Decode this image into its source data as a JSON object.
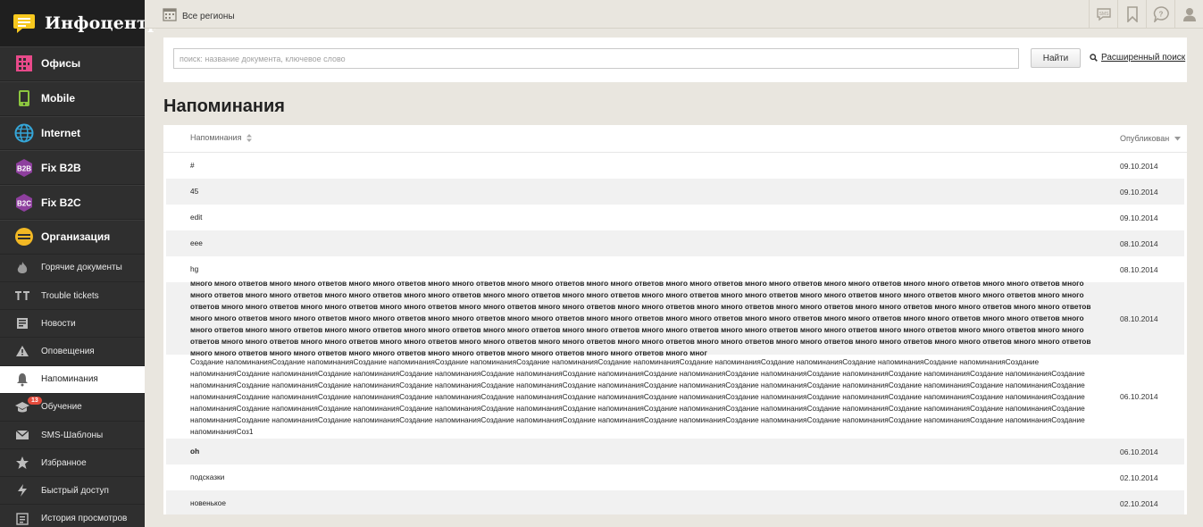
{
  "app": {
    "title": "Инфоцентр"
  },
  "sidebar": {
    "main_items": [
      {
        "label": "Офисы",
        "icon": "building-icon",
        "color": "#e84a8a"
      },
      {
        "label": "Mobile",
        "icon": "phone-icon",
        "color": "#8cc63f"
      },
      {
        "label": "Internet",
        "icon": "globe-icon",
        "color": "#35a6d8"
      },
      {
        "label": "Fix B2B",
        "icon": "b2b-icon",
        "color": "#8e3f9e"
      },
      {
        "label": "Fix B2C",
        "icon": "b2c-icon",
        "color": "#8e3f9e"
      },
      {
        "label": "Организация",
        "icon": "organization-icon",
        "color": "#f2b824"
      }
    ],
    "sub_items": [
      {
        "label": "Горячие документы",
        "icon": "fire-icon"
      },
      {
        "label": "Trouble tickets",
        "icon": "tt-icon"
      },
      {
        "label": "Новости",
        "icon": "news-icon"
      },
      {
        "label": "Оповещения",
        "icon": "warning-icon"
      },
      {
        "label": "Напоминания",
        "icon": "bell-icon",
        "active": true
      },
      {
        "label": "Обучение",
        "icon": "graduation-cap-icon",
        "badge": "13"
      },
      {
        "label": "SMS-Шаблоны",
        "icon": "envelope-icon"
      },
      {
        "label": "Избранное",
        "icon": "star-icon"
      },
      {
        "label": "Быстрый доступ",
        "icon": "lightning-icon"
      },
      {
        "label": "История просмотров",
        "icon": "history-icon"
      }
    ]
  },
  "topbar": {
    "region_label": "Все регионы",
    "icons": [
      "sms-icon",
      "bookmark-icon",
      "help-icon",
      "user-icon"
    ]
  },
  "search": {
    "placeholder": "поиск: название документа, ключевое слово",
    "value": "",
    "button_label": "Найти",
    "advanced_label": "Расширенный поиск"
  },
  "page": {
    "title": "Напоминания"
  },
  "table": {
    "columns": [
      "Напоминания",
      "Опубликован"
    ],
    "rows": [
      {
        "title": "#",
        "date": "09.10.2014"
      },
      {
        "title": "45",
        "date": "09.10.2014"
      },
      {
        "title": "edit",
        "date": "09.10.2014"
      },
      {
        "title": "eee",
        "date": "08.10.2014"
      },
      {
        "title": "hg",
        "date": "08.10.2014"
      },
      {
        "title": "много много ответов много много ответов много много ответов много много ответов много много ответов много много ответов много много ответов много много ответов много много ответов много много ответов много много ответов много много ответов много много ответов много много ответов много много ответов много много ответов много много ответов много много ответов много много ответов много много ответов много много ответов много много ответов много много ответов много много ответов много много ответов много много ответов много много ответов много много ответов много много ответов много много ответов много много ответов много много ответов много много ответов много много ответов много много ответов много много ответов много много ответов много много ответов много много ответов много много ответов много много ответов много много ответов много много ответов много много ответов много много ответов много много ответов много много ответов много много ответов много много ответов много много ответов много много ответов много много ответов много много ответов много много ответов много много ответов много много ответов много много ответов много много ответов много много ответов много много ответов много много ответов много много ответов много много ответов много много ответов много много ответов много много ответов много много ответов много много ответов много много ответов много много ответов много много ответов много много ответов много много ответов много много ответов много мног",
        "date": "08.10.2014"
      },
      {
        "title": "Создание напоминанияСоздание напоминанияСоздание напоминанияСоздание напоминанияСоздание напоминанияСоздание напоминанияСоздание напоминанияСоздание напоминанияСоздание напоминанияСоздание напоминанияСоздание напоминанияСоздание напоминанияСоздание напоминанияСоздание напоминанияСоздание напоминанияСоздание напоминанияСоздание напоминанияСоздание напоминанияСоздание напоминанияСоздание напоминанияСоздание напоминанияСоздание напоминанияСоздание напоминанияСоздание напоминанияСоздание напоминанияСоздание напоминанияСоздание напоминанияСоздание напоминанияСоздание напоминанияСоздание напоминанияСоздание напоминанияСоздание напоминанияСоздание напоминанияСоздание напоминанияСоздание напоминанияСоздание напоминанияСоздание напоминанияСоздание напоминанияСоздание напоминанияСоздание напоминанияСоздание напоминанияСоздание напоминанияСоздание напоминанияСоздание напоминанияСоздание напоминанияСоздание напоминанияСоздание напоминанияСоздание напоминанияСоздание напоминанияСоздание напоминанияСоздание напоминанияСоздание напоминанияСоздание напоминанияСоздание напоминанияСоздание напоминанияСоздание напоминанияСоздание напоминанияСоздание напоминанияСоздание напоминанияСоздание напоминанияСоздание напоминанияСоздание напоминанияСоздание напоминанияСоздание напоминанияСоздание напоминанияСоздание напоминанияСоз1",
        "date": "06.10.2014"
      },
      {
        "title": "oh",
        "date": "06.10.2014"
      },
      {
        "title": "подсказки",
        "date": "02.10.2014"
      },
      {
        "title": "новенькое",
        "date": "02.10.2014"
      }
    ]
  }
}
